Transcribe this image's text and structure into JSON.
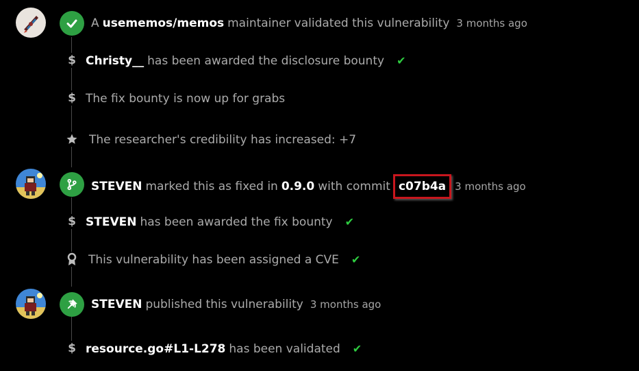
{
  "events": [
    {
      "kind": "validated",
      "prefix": "A",
      "org": "usememos/memos",
      "text1": "maintainer",
      "text2": "validated this vulnerability",
      "time": "3 months ago"
    },
    {
      "kind": "bounty",
      "actor": "Christy__",
      "text": "has been awarded the disclosure bounty"
    },
    {
      "kind": "bounty",
      "text": "The fix bounty is now up for grabs"
    },
    {
      "kind": "credibility",
      "text": "The researcher's credibility has increased: +7"
    },
    {
      "kind": "fixed",
      "actor": "STEVEN",
      "text1": "marked this as fixed in",
      "version": "0.9.0",
      "text2": "with commit",
      "commit": "c07b4a",
      "time": "3 months ago"
    },
    {
      "kind": "bounty",
      "actor": "STEVEN",
      "text": "has been awarded the fix bounty"
    },
    {
      "kind": "cve",
      "text": "This vulnerability has been assigned a CVE"
    },
    {
      "kind": "published",
      "actor": "STEVEN",
      "text": "published this vulnerability",
      "time": "3 months ago"
    },
    {
      "kind": "validated-file",
      "file": "resource.go#L1-L278",
      "text": "has been validated"
    }
  ],
  "icons": {
    "check": "check-icon",
    "dollar": "dollar-icon",
    "star": "star-icon",
    "branch": "git-branch-icon",
    "award": "award-icon",
    "megaphone": "publish-icon"
  },
  "glyphs": {
    "dollar": "$",
    "check": "✔"
  },
  "colors": {
    "accent_green": "#2ea043",
    "highlight_red": "#c8161d",
    "background": "#000000"
  }
}
